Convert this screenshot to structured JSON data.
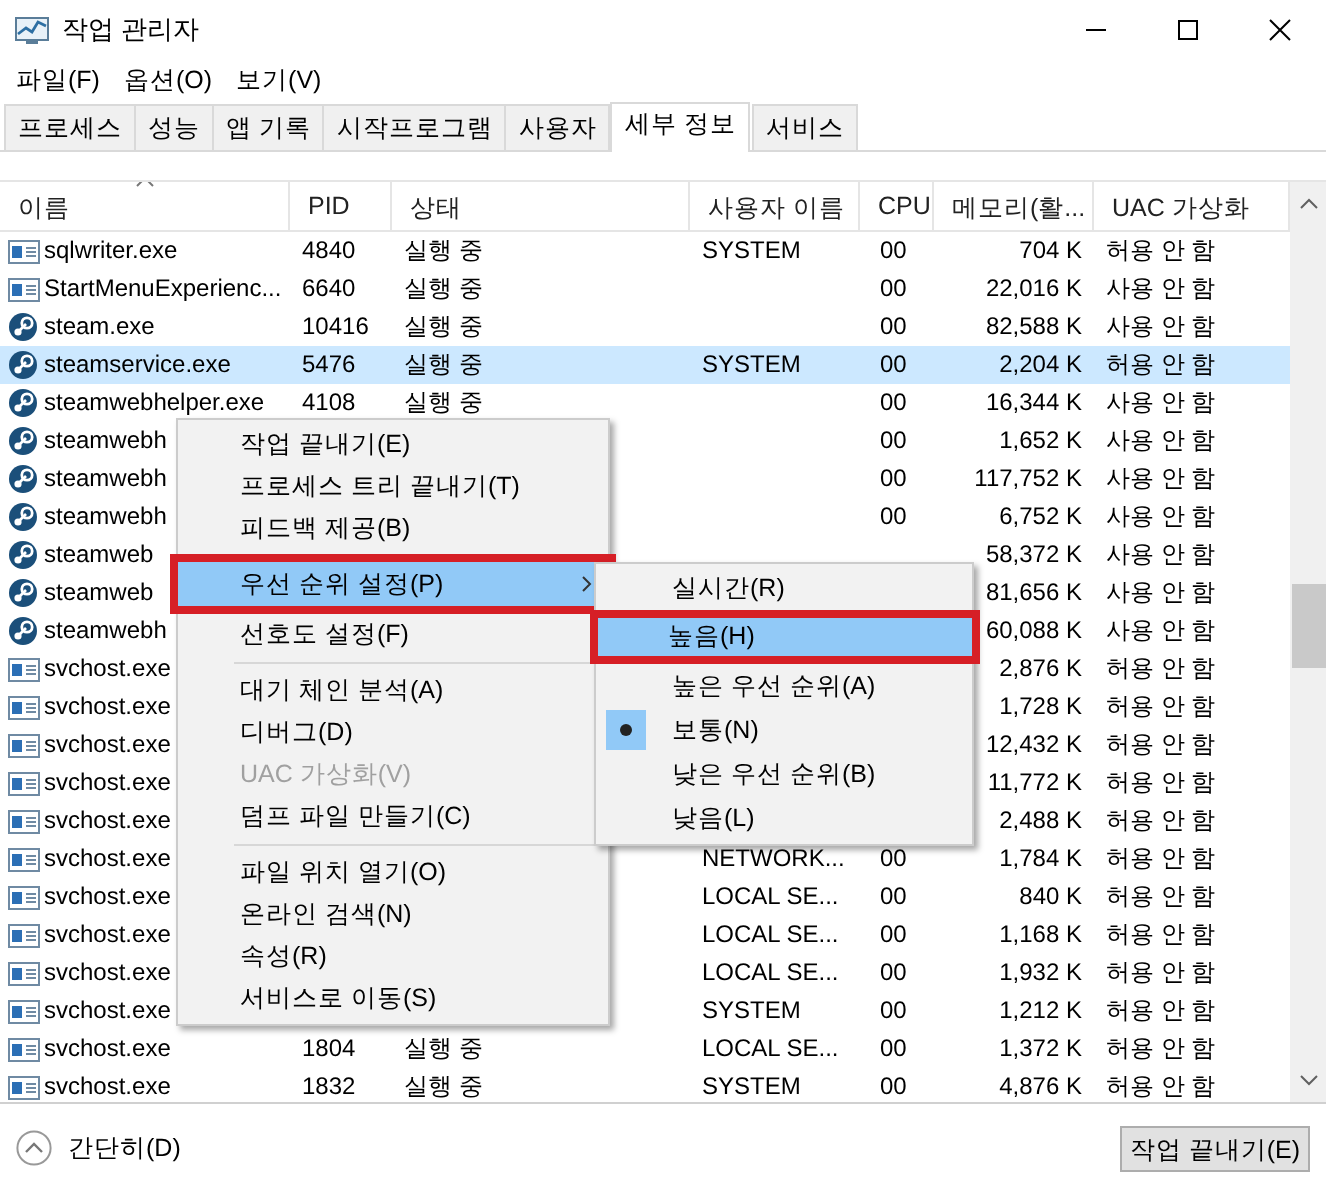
{
  "window": {
    "title": "작업 관리자"
  },
  "menu_bar": [
    "파일(F)",
    "옵션(O)",
    "보기(V)"
  ],
  "tabs": [
    {
      "label": "프로세스",
      "selected": false
    },
    {
      "label": "성능",
      "selected": false
    },
    {
      "label": "앱 기록",
      "selected": false
    },
    {
      "label": "시작프로그램",
      "selected": false
    },
    {
      "label": "사용자",
      "selected": false
    },
    {
      "label": "세부 정보",
      "selected": true
    },
    {
      "label": "서비스",
      "selected": false
    }
  ],
  "table": {
    "columns": [
      {
        "label": "이름",
        "sorted": true
      },
      {
        "label": "PID",
        "sorted": false
      },
      {
        "label": "상태",
        "sorted": false
      },
      {
        "label": "사용자 이름",
        "sorted": false
      },
      {
        "label": "CPU",
        "sorted": false
      },
      {
        "label": "메모리(활...",
        "sorted": false
      },
      {
        "label": "UAC 가상화",
        "sorted": false
      }
    ],
    "rows": [
      {
        "kind": "window",
        "name": "sqlwriter.exe",
        "pid": "4840",
        "status": "실행 중",
        "user": "SYSTEM",
        "cpu": "00",
        "memory": "704 K",
        "uac": "허용 안 함",
        "selected": false
      },
      {
        "kind": "window",
        "name": "StartMenuExperienc...",
        "pid": "6640",
        "status": "실행 중",
        "cpu": "00",
        "memory": "22,016 K",
        "uac": "사용 안 함",
        "selected": false
      },
      {
        "kind": "steam",
        "name": "steam.exe",
        "pid": "10416",
        "status": "실행 중",
        "cpu": "00",
        "memory": "82,588 K",
        "uac": "사용 안 함",
        "selected": false
      },
      {
        "kind": "steam",
        "name": "steamservice.exe",
        "pid": "5476",
        "status": "실행 중",
        "user": "SYSTEM",
        "cpu": "00",
        "memory": "2,204 K",
        "uac": "허용 안 함",
        "selected": true
      },
      {
        "kind": "steam",
        "name": "steamwebhelper.exe",
        "pid": "4108",
        "status": "실행 중",
        "cpu": "00",
        "memory": "16,344 K",
        "uac": "사용 안 함",
        "selected": false
      },
      {
        "kind": "steam",
        "name": "steamwebh",
        "cpu": "00",
        "memory": "1,652 K",
        "uac": "사용 안 함",
        "selected": false
      },
      {
        "kind": "steam",
        "name": "steamwebh",
        "cpu": "00",
        "memory": "117,752 K",
        "uac": "사용 안 함",
        "selected": false
      },
      {
        "kind": "steam",
        "name": "steamwebh",
        "cpu": "00",
        "memory": "6,752 K",
        "uac": "사용 안 함",
        "selected": false
      },
      {
        "kind": "steam",
        "name": "steamweb",
        "memory": "58,372 K",
        "uac": "사용 안 함",
        "selected": false
      },
      {
        "kind": "steam",
        "name": "steamweb",
        "memory": "81,656 K",
        "uac": "사용 안 함",
        "selected": false
      },
      {
        "kind": "steam",
        "name": "steamwebh",
        "memory": "60,088 K",
        "uac": "사용 안 함",
        "selected": false
      },
      {
        "kind": "window",
        "name": "svchost.exe",
        "memory": "2,876 K",
        "uac": "허용 안 함",
        "selected": false
      },
      {
        "kind": "window",
        "name": "svchost.exe",
        "memory": "1,728 K",
        "uac": "허용 안 함",
        "selected": false
      },
      {
        "kind": "window",
        "name": "svchost.exe",
        "memory": "12,432 K",
        "uac": "허용 안 함",
        "selected": false
      },
      {
        "kind": "window",
        "name": "svchost.exe",
        "memory": "11,772 K",
        "uac": "허용 안 함",
        "selected": false
      },
      {
        "kind": "window",
        "name": "svchost.exe",
        "memory": "2,488 K",
        "uac": "허용 안 함",
        "selected": false
      },
      {
        "kind": "window",
        "name": "svchost.exe",
        "user": "NETWORK...",
        "cpu": "00",
        "memory": "1,784 K",
        "uac": "허용 안 함",
        "selected": false
      },
      {
        "kind": "window",
        "name": "svchost.exe",
        "user": "LOCAL SE...",
        "cpu": "00",
        "memory": "840 K",
        "uac": "허용 안 함",
        "selected": false
      },
      {
        "kind": "window",
        "name": "svchost.exe",
        "user": "LOCAL SE...",
        "cpu": "00",
        "memory": "1,168 K",
        "uac": "허용 안 함",
        "selected": false
      },
      {
        "kind": "window",
        "name": "svchost.exe",
        "user": "LOCAL SE...",
        "cpu": "00",
        "memory": "1,932 K",
        "uac": "허용 안 함",
        "selected": false
      },
      {
        "kind": "window",
        "name": "svchost.exe",
        "user": "SYSTEM",
        "cpu": "00",
        "memory": "1,212 K",
        "uac": "허용 안 함",
        "selected": false
      },
      {
        "kind": "window",
        "name": "svchost.exe",
        "pid": "1804",
        "status": "실행 중",
        "user": "LOCAL SE...",
        "cpu": "00",
        "memory": "1,372 K",
        "uac": "허용 안 함",
        "selected": false
      },
      {
        "kind": "window",
        "name": "svchost.exe",
        "pid": "1832",
        "status": "실행 중",
        "user": "SYSTEM",
        "cpu": "00",
        "memory": "4,876 K",
        "uac": "허용 안 함",
        "selected": false
      }
    ]
  },
  "context_menu": {
    "groups": [
      [
        {
          "label": "작업 끝내기(E)",
          "highlighted": false,
          "outlined": false,
          "disabled": false,
          "has_submenu": false
        },
        {
          "label": "프로세스 트리 끝내기(T)",
          "highlighted": false,
          "outlined": false,
          "disabled": false,
          "has_submenu": false
        },
        {
          "label": "피드백 제공(B)",
          "highlighted": false,
          "outlined": false,
          "disabled": false,
          "has_submenu": false
        },
        {
          "label": "우선 순위 설정(P)",
          "highlighted": true,
          "outlined": true,
          "disabled": false,
          "has_submenu": true
        },
        {
          "label": "선호도 설정(F)",
          "highlighted": false,
          "outlined": false,
          "disabled": false,
          "has_submenu": false
        }
      ],
      [
        {
          "label": "대기 체인 분석(A)",
          "highlighted": false,
          "outlined": false,
          "disabled": false,
          "has_submenu": false
        },
        {
          "label": "디버그(D)",
          "highlighted": false,
          "outlined": false,
          "disabled": false,
          "has_submenu": false
        },
        {
          "label": "UAC 가상화(V)",
          "highlighted": false,
          "outlined": false,
          "disabled": true,
          "has_submenu": false
        },
        {
          "label": "덤프 파일 만들기(C)",
          "highlighted": false,
          "outlined": false,
          "disabled": false,
          "has_submenu": false
        }
      ],
      [
        {
          "label": "파일 위치 열기(O)",
          "highlighted": false,
          "outlined": false,
          "disabled": false,
          "has_submenu": false
        },
        {
          "label": "온라인 검색(N)",
          "highlighted": false,
          "outlined": false,
          "disabled": false,
          "has_submenu": false
        },
        {
          "label": "속성(R)",
          "highlighted": false,
          "outlined": false,
          "disabled": false,
          "has_submenu": false
        },
        {
          "label": "서비스로 이동(S)",
          "highlighted": false,
          "outlined": false,
          "disabled": false,
          "has_submenu": false
        }
      ]
    ]
  },
  "submenu": {
    "items": [
      {
        "label": "실시간(R)",
        "highlighted": false,
        "outlined": false,
        "checked": false
      },
      {
        "label": "높음(H)",
        "highlighted": true,
        "outlined": true,
        "checked": false
      },
      {
        "label": "높은 우선 순위(A)",
        "highlighted": false,
        "outlined": false,
        "checked": false
      },
      {
        "label": "보통(N)",
        "highlighted": false,
        "outlined": false,
        "checked": true
      },
      {
        "label": "낮은 우선 순위(B)",
        "highlighted": false,
        "outlined": false,
        "checked": false
      },
      {
        "label": "낮음(L)",
        "highlighted": false,
        "outlined": false,
        "checked": false
      }
    ]
  },
  "footer": {
    "collapse_label": "간단히(D)",
    "end_task_button": "작업 끝내기(E)"
  }
}
